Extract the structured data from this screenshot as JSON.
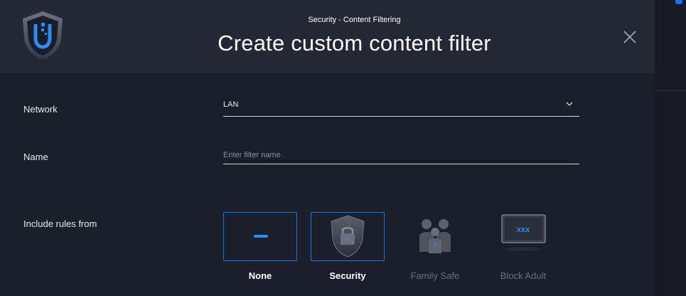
{
  "colors": {
    "accent": "#1a73e8",
    "header_bg": "#242734",
    "body_bg": "#1b1e2b"
  },
  "header": {
    "subtitle": "Security - Content Filtering",
    "title": "Create custom content filter",
    "logo_icon": "unifi-shield-icon",
    "close_icon": "close-icon"
  },
  "form": {
    "network": {
      "label": "Network",
      "value": "LAN",
      "icon": "chevron-down-icon"
    },
    "name": {
      "label": "Name",
      "value": "",
      "placeholder": "Enter filter name"
    },
    "include_rules": {
      "label": "Include rules from",
      "options": [
        {
          "label": "None",
          "icon": "dash-icon",
          "selected": true,
          "enabled": true
        },
        {
          "label": "Security",
          "icon": "shield-lock-icon",
          "selected": true,
          "enabled": true
        },
        {
          "label": "Family Safe",
          "icon": "family-icon",
          "selected": false,
          "enabled": false
        },
        {
          "label": "Block Adult",
          "icon": "xxx-screen-icon",
          "selected": false,
          "enabled": false
        }
      ]
    }
  }
}
